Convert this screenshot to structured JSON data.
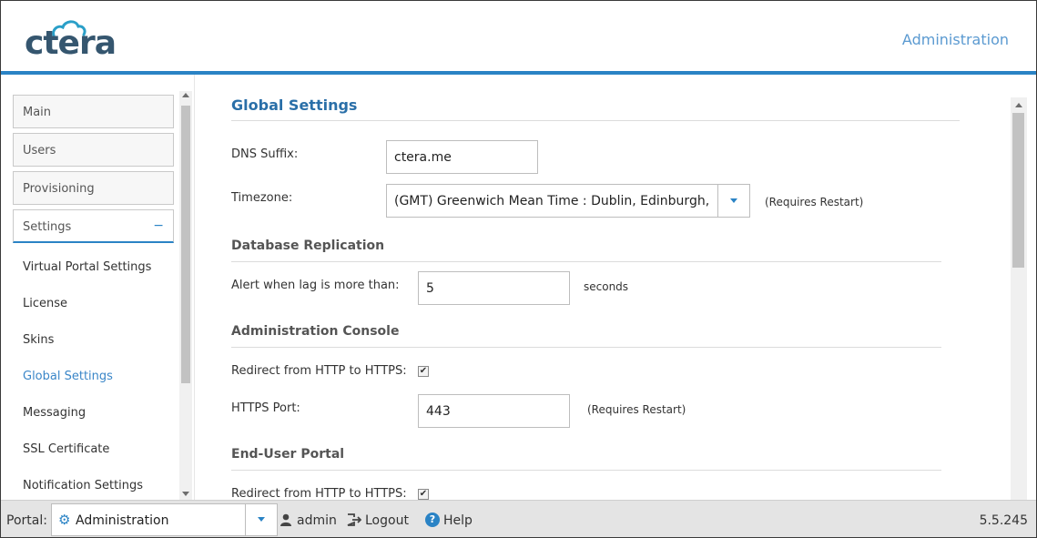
{
  "app": {
    "logo_text": "ctera",
    "section_title": "Administration",
    "brand_color": "#2a83c5"
  },
  "sidebar": {
    "sections": [
      {
        "label": "Main"
      },
      {
        "label": "Users"
      },
      {
        "label": "Provisioning"
      },
      {
        "label": "Settings",
        "expanded_icon": "−"
      }
    ],
    "settings_items": [
      {
        "label": "Virtual Portal Settings"
      },
      {
        "label": "License"
      },
      {
        "label": "Skins"
      },
      {
        "label": "Global Settings"
      },
      {
        "label": "Messaging"
      },
      {
        "label": "SSL Certificate"
      },
      {
        "label": "Notification Settings"
      }
    ],
    "selected_item": "Global Settings"
  },
  "main": {
    "title": "Global Settings",
    "dns_suffix": {
      "label": "DNS Suffix:",
      "value": "ctera.me"
    },
    "timezone": {
      "label": "Timezone:",
      "value": "(GMT) Greenwich Mean Time : Dublin, Edinburgh, Lisbon, London",
      "note": "(Requires Restart)"
    },
    "db_replication": {
      "title": "Database Replication",
      "alert_label": "Alert when lag is more than:",
      "alert_value": "5",
      "alert_unit": "seconds"
    },
    "admin_console": {
      "title": "Administration Console",
      "redirect_label": "Redirect from HTTP to HTTPS:",
      "redirect_checked": true,
      "https_port_label": "HTTPS Port:",
      "https_port_value": "443",
      "https_port_note": "(Requires Restart)"
    },
    "end_user_portal": {
      "title": "End-User Portal",
      "redirect_label": "Redirect from HTTP to HTTPS:",
      "redirect_checked": true
    },
    "checkmark": "✔"
  },
  "footer": {
    "portal_label": "Portal:",
    "portal_value": "Administration",
    "user": "admin",
    "logout": "Logout",
    "help": "Help",
    "help_glyph": "?",
    "version": "5.5.245"
  }
}
